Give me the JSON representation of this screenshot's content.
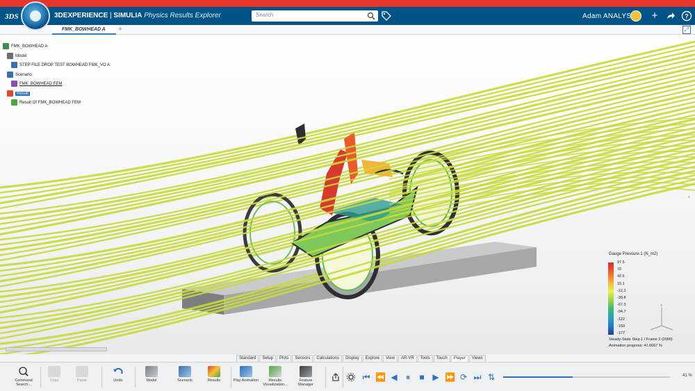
{
  "header": {
    "brand_3d": "3DEXPERIENCE",
    "brand_sep": " | ",
    "brand_simulia": "SIMULIA",
    "brand_app": "Physics Results Explorer",
    "search_placeholder": "Search",
    "user_name": "Adam ANALYST"
  },
  "tabs": [
    {
      "label": "FMK_BOWHEAD A"
    }
  ],
  "tree": {
    "root": "FMK_BOWHEAD A",
    "model": "Model",
    "step_file": "STEP FILE DROP TEST BOWHEAD FMK_VO A",
    "scenario": "Scenario",
    "fem": "FMK_BOWHEAD FEM",
    "result": "Result",
    "result_of": "Result Of FMK_BOWHEAD FEM"
  },
  "legend": {
    "title": "Gauge Pressure.1 (N_m2)",
    "values": [
      "97.5",
      "70",
      "42.6",
      "15.1",
      "-12.3",
      "-39.8",
      "-67.3",
      "-94.7",
      "-122",
      "-150",
      "-177"
    ],
    "step": "Steady-State Step.1 / Frame 2 (2000)",
    "animation": "Animation progress: 41.6667 %"
  },
  "toolbar_tabs": [
    "Standard",
    "Setup",
    "Plots",
    "Sensors",
    "Calculations",
    "Display",
    "Explore",
    "View",
    "AR-VR",
    "Tools",
    "Touch",
    "Player",
    "Views"
  ],
  "toolbar_tabs_active": "Player",
  "tools": [
    {
      "label": "Command Search...",
      "icon": "search-icon"
    },
    {
      "label": "Copy",
      "icon": "copy-icon"
    },
    {
      "label": "Paste",
      "icon": "paste-icon"
    },
    {
      "label": "Undo",
      "icon": "undo-icon"
    },
    {
      "label": "Model",
      "icon": "model-icon"
    },
    {
      "label": "Scenario",
      "icon": "scenario-icon"
    },
    {
      "label": "Results",
      "icon": "results-icon"
    },
    {
      "label": "Play Animation",
      "icon": "play-animation-icon"
    },
    {
      "label": "Results Visualization...",
      "icon": "results-visualization-icon"
    },
    {
      "label": "Feature Manager",
      "icon": "feature-manager-icon"
    }
  ],
  "player": {
    "progress_fraction": 0.4167,
    "progress_text": "41 %"
  },
  "colors": {
    "header": "#005386",
    "accent": "#2f6fbf",
    "streamline": "#c8d93a",
    "top_strip": "#e8352c"
  }
}
